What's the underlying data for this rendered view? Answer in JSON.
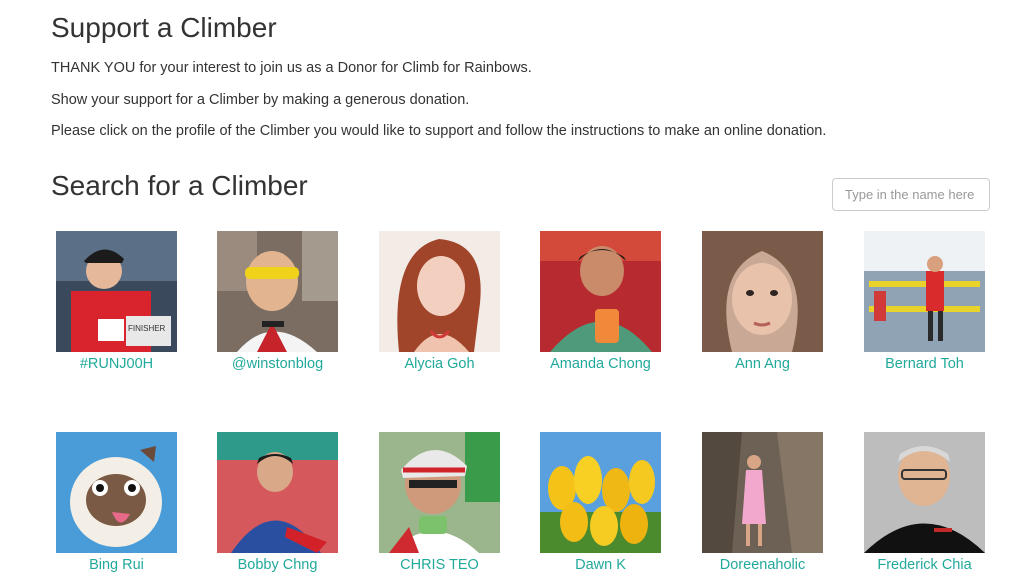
{
  "support": {
    "title": "Support a Climber",
    "paragraphs": [
      "THANK YOU for your interest to join us as a Donor for Climb for Rainbows.",
      "Show your support for a Climber by making a generous donation.",
      "Please click on the profile of the Climber you would like to support and follow the instructions to make an online donation."
    ]
  },
  "search": {
    "title": "Search for a Climber",
    "placeholder": "Type in the name here",
    "value": ""
  },
  "climbers": [
    {
      "name": "#RUNJ00H"
    },
    {
      "name": "@winstonblog"
    },
    {
      "name": "Alycia Goh"
    },
    {
      "name": "Amanda Chong"
    },
    {
      "name": "Ann Ang"
    },
    {
      "name": "Bernard Toh"
    },
    {
      "name": "Bing Rui"
    },
    {
      "name": "Bobby Chng"
    },
    {
      "name": "CHRIS TEO"
    },
    {
      "name": "Dawn K"
    },
    {
      "name": "Doreenaholic"
    },
    {
      "name": "Frederick Chia"
    }
  ],
  "colors": {
    "link": "#21a99a",
    "text": "#333333"
  }
}
